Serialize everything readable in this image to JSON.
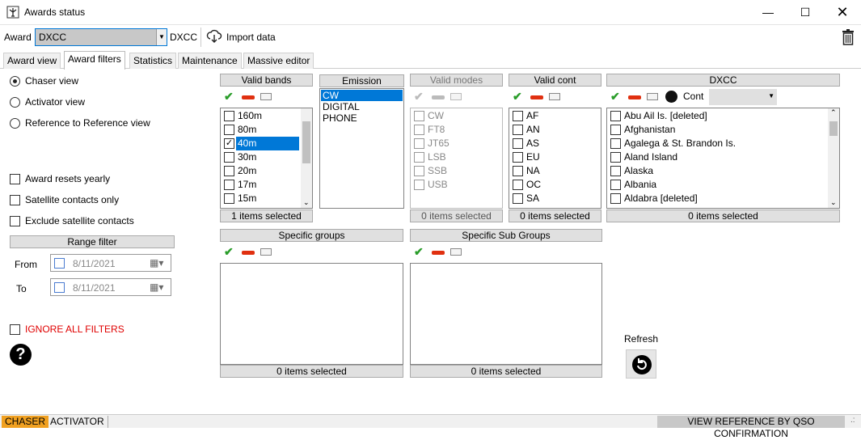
{
  "window": {
    "title": "Awards status",
    "icon": "antenna-icon",
    "controls": [
      "minimize-icon",
      "maximize-icon",
      "close-icon"
    ]
  },
  "toolbar": {
    "award_label": "Award",
    "award_value": "DXCC",
    "award_name": "DXCC",
    "import_label": "Import data",
    "trash_icon": "trash-icon"
  },
  "tabs": [
    "Award view",
    "Award filters",
    "Statistics",
    "Maintenance",
    "Massive editor"
  ],
  "views": {
    "chaser": "Chaser view",
    "activator": "Activator view",
    "ref2ref": "Reference to Reference view",
    "selected": "chaser"
  },
  "options": {
    "resets_yearly": "Award resets yearly",
    "sat_only": "Satellite contacts only",
    "exclude_sat": "Exclude satellite contacts"
  },
  "range": {
    "title": "Range filter",
    "from_label": "From",
    "to_label": "To",
    "from_value": "8/11/2021",
    "to_value": "8/11/2021"
  },
  "ignore_filters": "IGNORE ALL FILTERS",
  "ignore_color": "#e00000",
  "bands": {
    "title": "Valid bands",
    "items": [
      {
        "label": "160m",
        "checked": false
      },
      {
        "label": "80m",
        "checked": false
      },
      {
        "label": "40m",
        "checked": true
      },
      {
        "label": "30m",
        "checked": false
      },
      {
        "label": "20m",
        "checked": false
      },
      {
        "label": "17m",
        "checked": false
      },
      {
        "label": "15m",
        "checked": false
      }
    ],
    "footer": "1 items selected"
  },
  "emission": {
    "title": "Emission",
    "items": [
      "CW",
      "DIGITAL",
      "PHONE"
    ],
    "selected": "CW"
  },
  "modes": {
    "title": "Valid modes",
    "items": [
      "CW",
      "FT8",
      "JT65",
      "LSB",
      "SSB",
      "USB"
    ],
    "footer": "0 items selected"
  },
  "continents": {
    "title": "Valid cont",
    "items": [
      "AF",
      "AN",
      "AS",
      "EU",
      "NA",
      "OC",
      "SA"
    ],
    "footer": "0 items selected"
  },
  "dxcc": {
    "title": "DXCC",
    "cont_label": "Cont",
    "items": [
      "Abu Ail Is. [deleted]",
      "Afghanistan",
      "Agalega & St. Brandon Is.",
      "Aland Island",
      "Alaska",
      "Albania",
      "Aldabra [deleted]"
    ],
    "footer": "0 items selected"
  },
  "groups": {
    "title": "Specific groups",
    "footer": "0 items selected"
  },
  "subgroups": {
    "title": "Specific Sub Groups",
    "footer": "0 items selected"
  },
  "refresh_label": "Refresh",
  "status": {
    "chaser": "CHASER",
    "activator": "ACTIVATOR",
    "view_ref": "VIEW REFERENCE BY QSO CONFIRMATION",
    "chaser_color": "#f0a020"
  }
}
